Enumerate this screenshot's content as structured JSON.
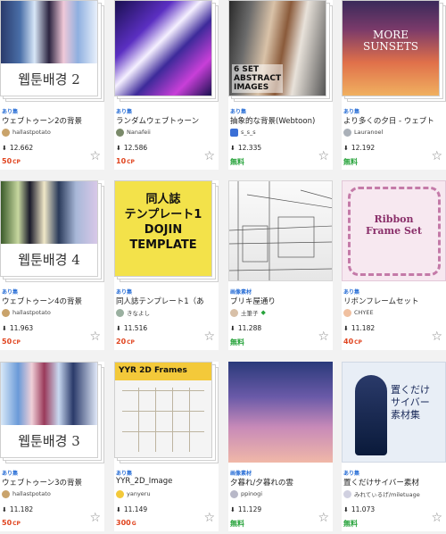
{
  "cards": [
    {
      "badge": "あり集",
      "title": "ウェブトゥーン2の背景",
      "author": "hallastpotato",
      "count": "12.662",
      "price": "50",
      "unit": "CP",
      "thumb_text": "웹툰배경 2"
    },
    {
      "badge": "あり集",
      "title": "ランダムウェブトゥーン",
      "author": "Nanafeii",
      "count": "12.586",
      "price": "10",
      "unit": "CP"
    },
    {
      "badge": "あり集",
      "title": "抽象的な背景(Webtoon)",
      "author": "s_s_s",
      "count": "12.335",
      "price": "無料",
      "unit": "",
      "thumb_text": "6 SET\nABSTRACT\nIMAGES"
    },
    {
      "badge": "あり集",
      "title": "より多くの夕日 - ウェブト",
      "author": "Lauranoel",
      "count": "12.192",
      "price": "無料",
      "unit": "",
      "thumb_text": "MORE\nSUNSETS"
    },
    {
      "badge": "あり集",
      "title": "ウェブトゥーン4の背景",
      "author": "hallastpotato",
      "count": "11.963",
      "price": "50",
      "unit": "CP",
      "thumb_text": "웹툰배경 4"
    },
    {
      "badge": "あり集",
      "title": "同人誌テンプレート1（あ",
      "author": "きなよし",
      "count": "11.516",
      "price": "20",
      "unit": "CP",
      "thumb_text": "同人誌\nテンプレート1\nDOJIN\nTEMPLATE"
    },
    {
      "badge": "画像素材",
      "title": "ブリキ屋通り",
      "author": "土筆子",
      "count": "11.288",
      "price": "無料",
      "unit": ""
    },
    {
      "badge": "あり集",
      "title": "リボンフレームセット",
      "author": "CHYEE",
      "count": "11.182",
      "price": "40",
      "unit": "CP",
      "thumb_text": "Ribbon\nFrame Set"
    },
    {
      "badge": "あり集",
      "title": "ウェブトゥーン3の背景",
      "author": "hallastpotato",
      "count": "11.182",
      "price": "50",
      "unit": "CP",
      "thumb_text": "웹툰배경 3"
    },
    {
      "badge": "あり集",
      "title": "YYR_2D_Image",
      "author": "yanyeru",
      "count": "11.149",
      "price": "300",
      "unit": "G",
      "thumb_text": "YYR 2D Frames"
    },
    {
      "badge": "画像素材",
      "title": "夕暮れ/夕暮れの雲",
      "author": "ppinogi",
      "count": "11.129",
      "price": "無料",
      "unit": ""
    },
    {
      "badge": "あり集",
      "title": "置くだけサイバー素材",
      "author": "みれてぃるげ/miletuage",
      "count": "11.073",
      "price": "無料",
      "unit": "",
      "thumb_text": "置くだけ\nサイバー\n素材集"
    }
  ],
  "colors": {
    "paid": "#e0441f",
    "free": "#27a33b",
    "badge": "#2a6fd6"
  },
  "icons": {
    "download": "download-icon",
    "favorite": "star-outline-icon"
  }
}
